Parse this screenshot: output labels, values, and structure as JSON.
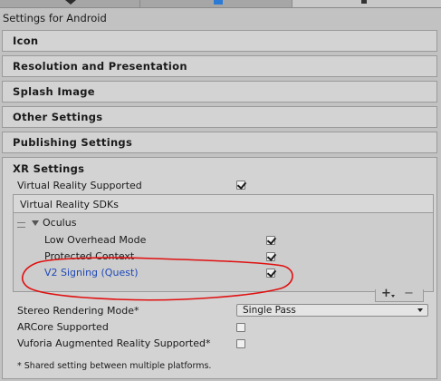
{
  "title": "Settings for Android",
  "sections": [
    {
      "label": "Icon"
    },
    {
      "label": "Resolution and Presentation"
    },
    {
      "label": "Splash Image"
    },
    {
      "label": "Other Settings"
    },
    {
      "label": "Publishing Settings"
    }
  ],
  "xr": {
    "title": "XR Settings",
    "vr_supported": {
      "label": "Virtual Reality Supported",
      "checked": true
    },
    "sdks_header": "Virtual Reality SDKs",
    "sdk_name": "Oculus",
    "sdk_options": [
      {
        "label": "Low Overhead Mode",
        "checked": true
      },
      {
        "label": "Protected Context",
        "checked": true
      },
      {
        "label": "V2 Signing (Quest)",
        "checked": true
      }
    ],
    "add_label": "+",
    "remove_label": "−",
    "stereo_mode": {
      "label": "Stereo Rendering Mode*",
      "value": "Single Pass"
    },
    "arcore": {
      "label": "ARCore Supported",
      "checked": false
    },
    "vuforia": {
      "label": "Vuforia Augmented Reality Supported*",
      "checked": false
    },
    "footnote": "* Shared setting between multiple platforms."
  },
  "annotation_color": "#e01010"
}
